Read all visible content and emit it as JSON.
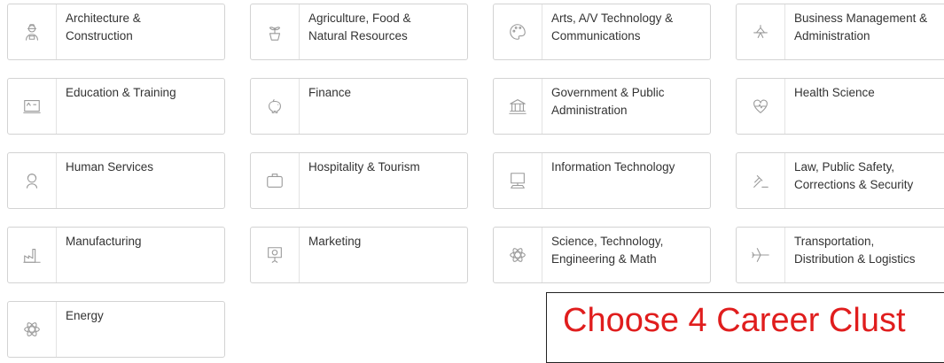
{
  "clusters": [
    {
      "label": "Architecture &\nConstruction",
      "icon": "worker-icon"
    },
    {
      "label": "Agriculture, Food &\nNatural Resources",
      "icon": "plant-icon"
    },
    {
      "label": "Arts, A/V Technology &\nCommunications",
      "icon": "palette-icon"
    },
    {
      "label": "Business Management &\nAdministration",
      "icon": "desk-lamp-icon"
    },
    {
      "label": "Education & Training",
      "icon": "chalkboard-icon"
    },
    {
      "label": "Finance",
      "icon": "piggy-bank-icon"
    },
    {
      "label": "Government & Public\nAdministration",
      "icon": "capitol-building-icon"
    },
    {
      "label": "Health Science",
      "icon": "heart-pulse-icon"
    },
    {
      "label": "Human Services",
      "icon": "person-headset-icon"
    },
    {
      "label": "Hospitality & Tourism",
      "icon": "suitcase-icon"
    },
    {
      "label": "Information Technology",
      "icon": "computer-icon"
    },
    {
      "label": "Law, Public Safety,\nCorrections & Security",
      "icon": "gavel-icon"
    },
    {
      "label": "Manufacturing",
      "icon": "factory-icon"
    },
    {
      "label": "Marketing",
      "icon": "presentation-board-icon"
    },
    {
      "label": "Science, Technology,\nEngineering & Math",
      "icon": "atom-icon"
    },
    {
      "label": "Transportation,\nDistribution & Logistics",
      "icon": "airplane-icon"
    },
    {
      "label": "Energy",
      "icon": "atom-icon"
    }
  ],
  "banner": {
    "text": "Choose 4 Career Clust",
    "color": "#e01d1d"
  },
  "colors": {
    "border": "#d3d3d3",
    "icon": "#9a9a9a",
    "text": "#333333"
  }
}
